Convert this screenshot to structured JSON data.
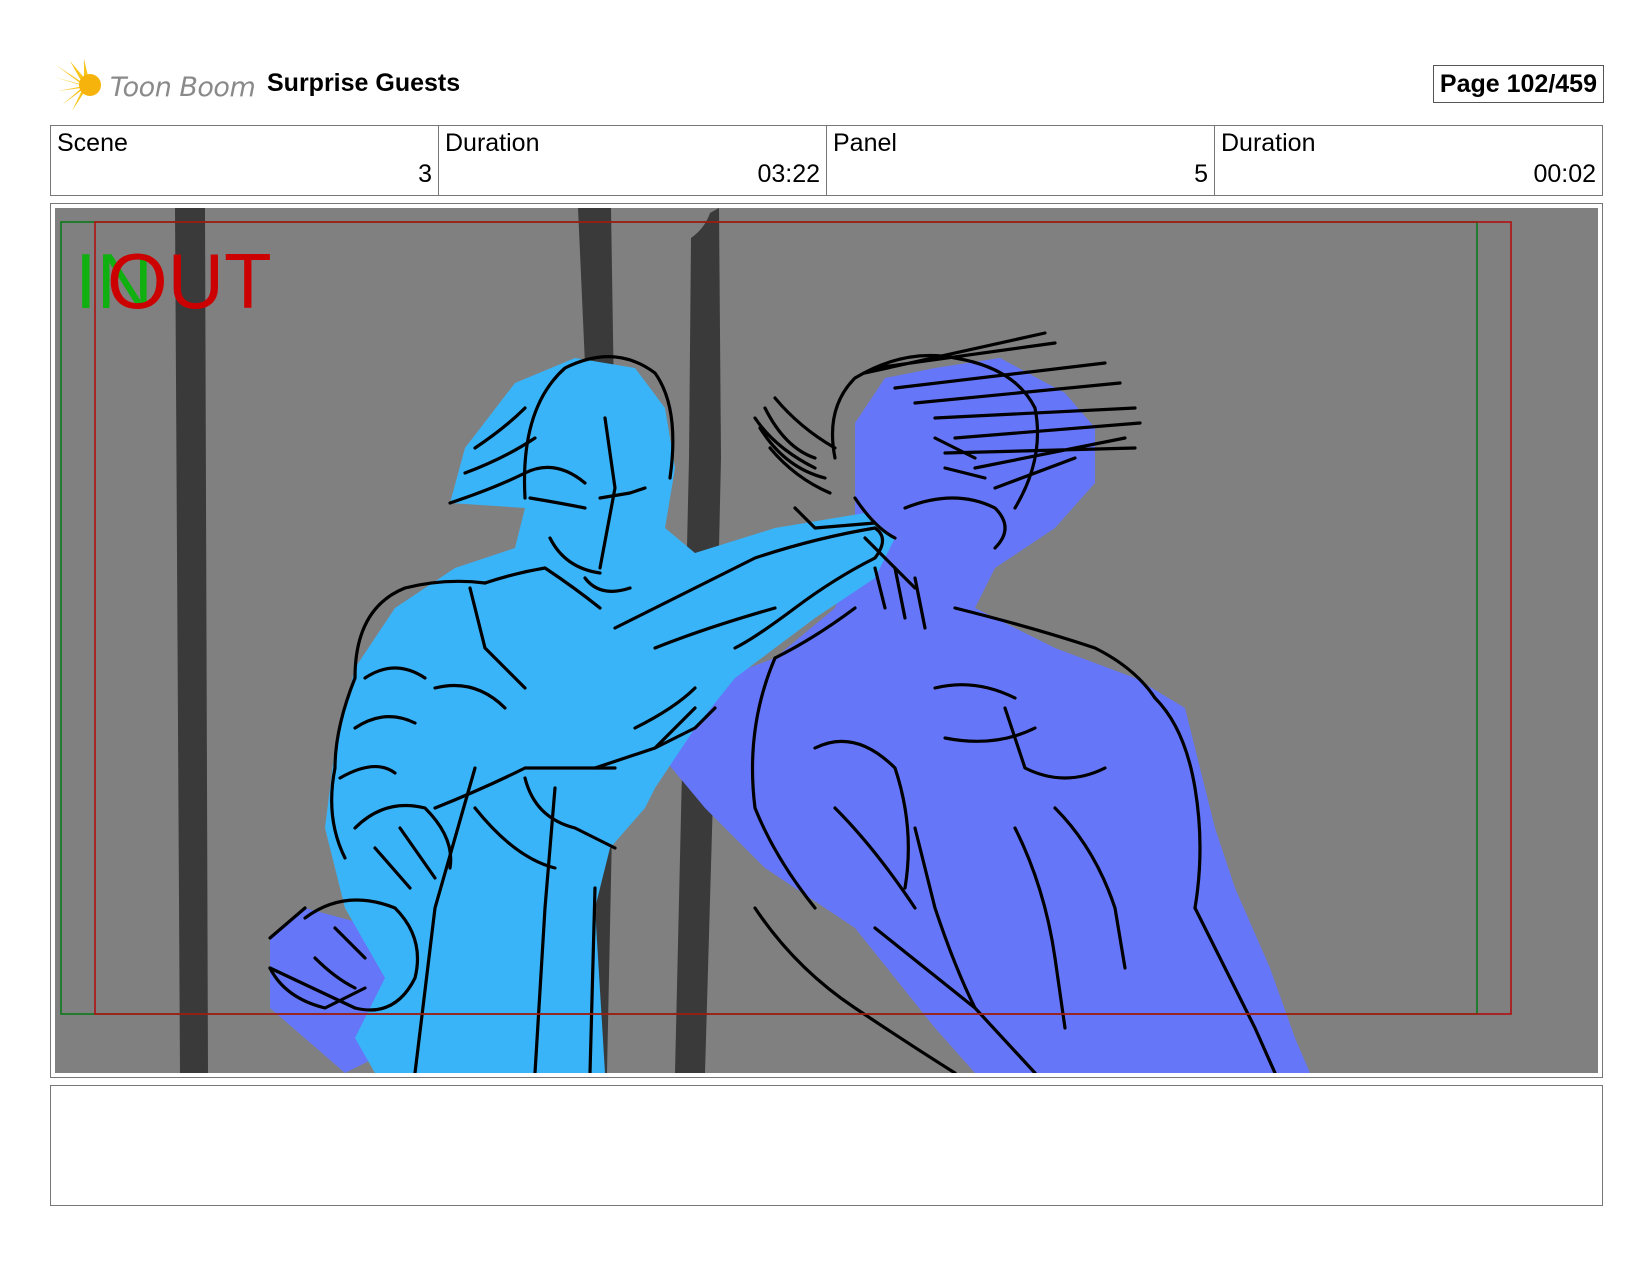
{
  "header": {
    "logo_text": "Toon Boom",
    "project_title": "Surprise Guests",
    "page_label": "Page 102/459"
  },
  "info": {
    "scene_label": "Scene",
    "scene_value": "3",
    "scene_duration_label": "Duration",
    "scene_duration_value": "03:22",
    "panel_label": "Panel",
    "panel_value": "5",
    "panel_duration_label": "Duration",
    "panel_duration_value": "00:02"
  },
  "panel": {
    "in_marker": "IN",
    "out_marker": "OUT",
    "colors": {
      "background": "#808080",
      "bars": "#3a3a3a",
      "left_figure": "#3ab4f8",
      "right_figure": "#6676f8",
      "in_marker": "#0fb00f",
      "out_marker": "#cc0000"
    }
  },
  "notes": {
    "text": ""
  }
}
